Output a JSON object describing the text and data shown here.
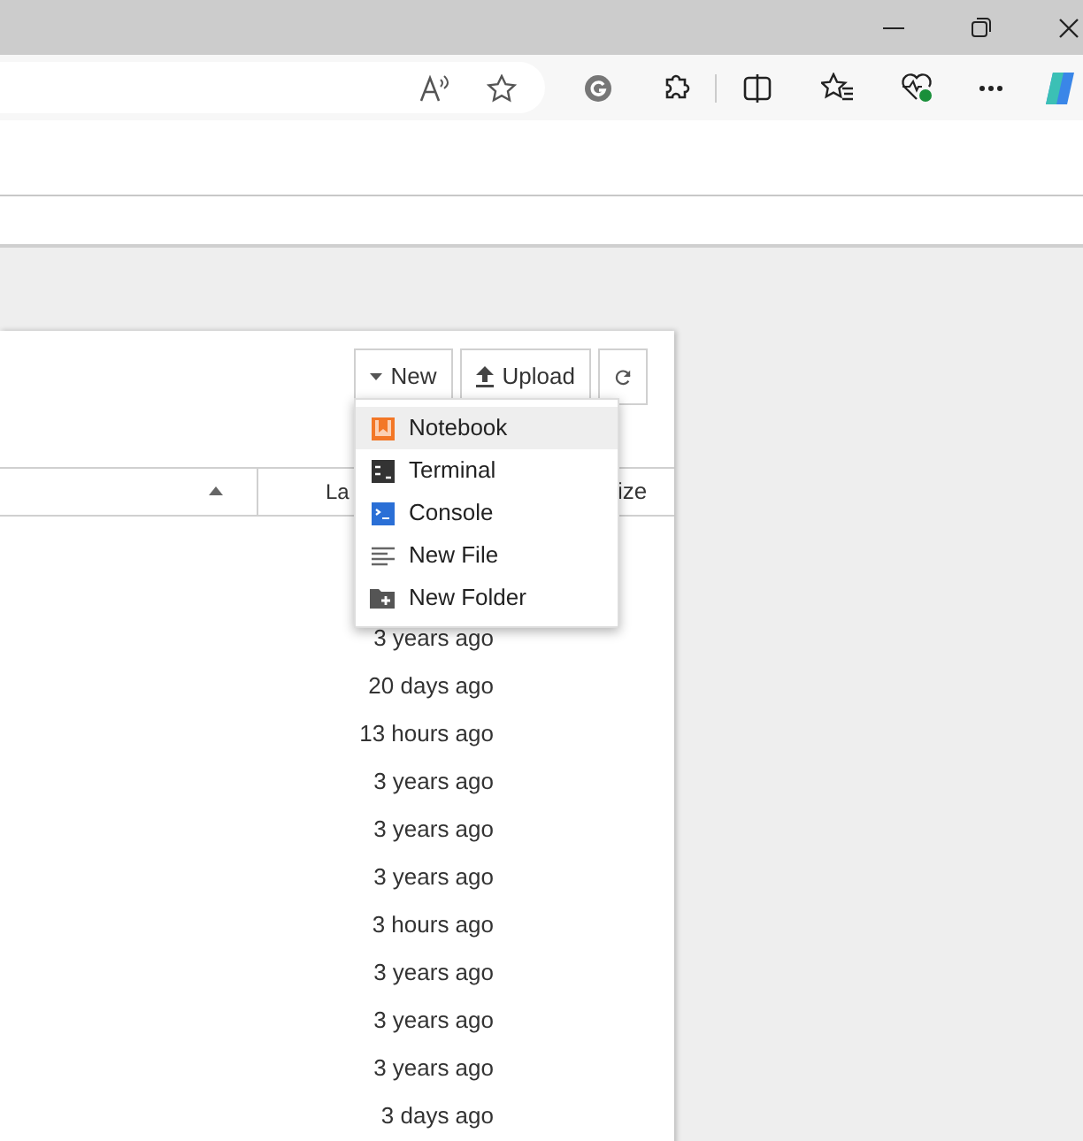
{
  "toolbar_buttons": [
    {
      "kind": "new",
      "label": "New"
    },
    {
      "kind": "upload",
      "label": "Upload"
    },
    {
      "kind": "refresh"
    }
  ],
  "columns": [
    "La",
    "ize"
  ],
  "rows": [
    "3 years ago",
    "20 days ago",
    "13 hours ago",
    "3 years ago",
    "3 years ago",
    "3 years ago",
    "3 hours ago",
    "3 years ago",
    "3 years ago",
    "3 years ago",
    "3 days ago"
  ],
  "menu": [
    {
      "kind": "notebook",
      "label": "Notebook",
      "selected": true
    },
    {
      "kind": "terminal",
      "label": "Terminal",
      "selected": false
    },
    {
      "kind": "console",
      "label": "Console",
      "selected": false
    },
    {
      "kind": "file",
      "label": "New File",
      "selected": false
    },
    {
      "kind": "folder",
      "label": "New Folder",
      "selected": false
    }
  ]
}
